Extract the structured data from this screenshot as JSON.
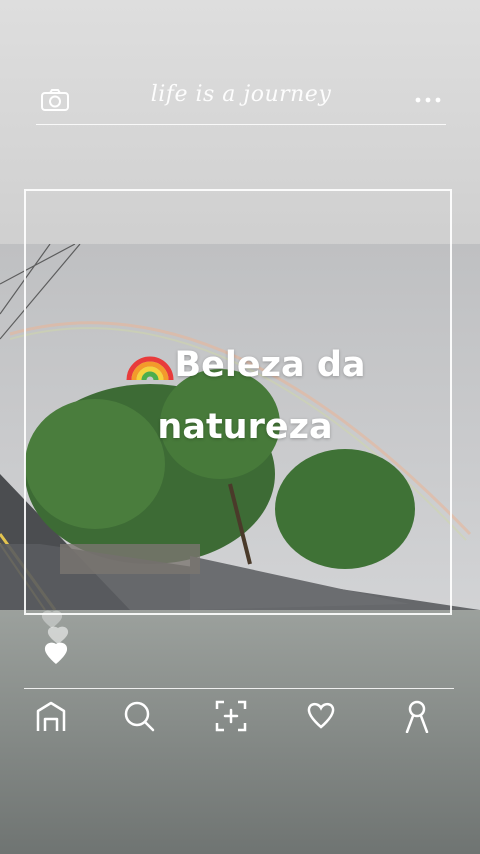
{
  "header": {
    "title": "life is a journey",
    "camera_icon": "camera-icon",
    "more_icon": "more-dots-icon"
  },
  "post": {
    "caption_line1": "Beleza da",
    "caption_line2": "natureza",
    "emoji": "rainbow-emoji"
  },
  "reactions": {
    "icon": "hearts-icon"
  },
  "nav": {
    "items": [
      {
        "icon": "home-icon"
      },
      {
        "icon": "search-icon"
      },
      {
        "icon": "add-post-icon"
      },
      {
        "icon": "heart-icon"
      },
      {
        "icon": "profile-icon"
      }
    ]
  },
  "colors": {
    "line": "#ffffff",
    "caption": "#ffffff"
  }
}
